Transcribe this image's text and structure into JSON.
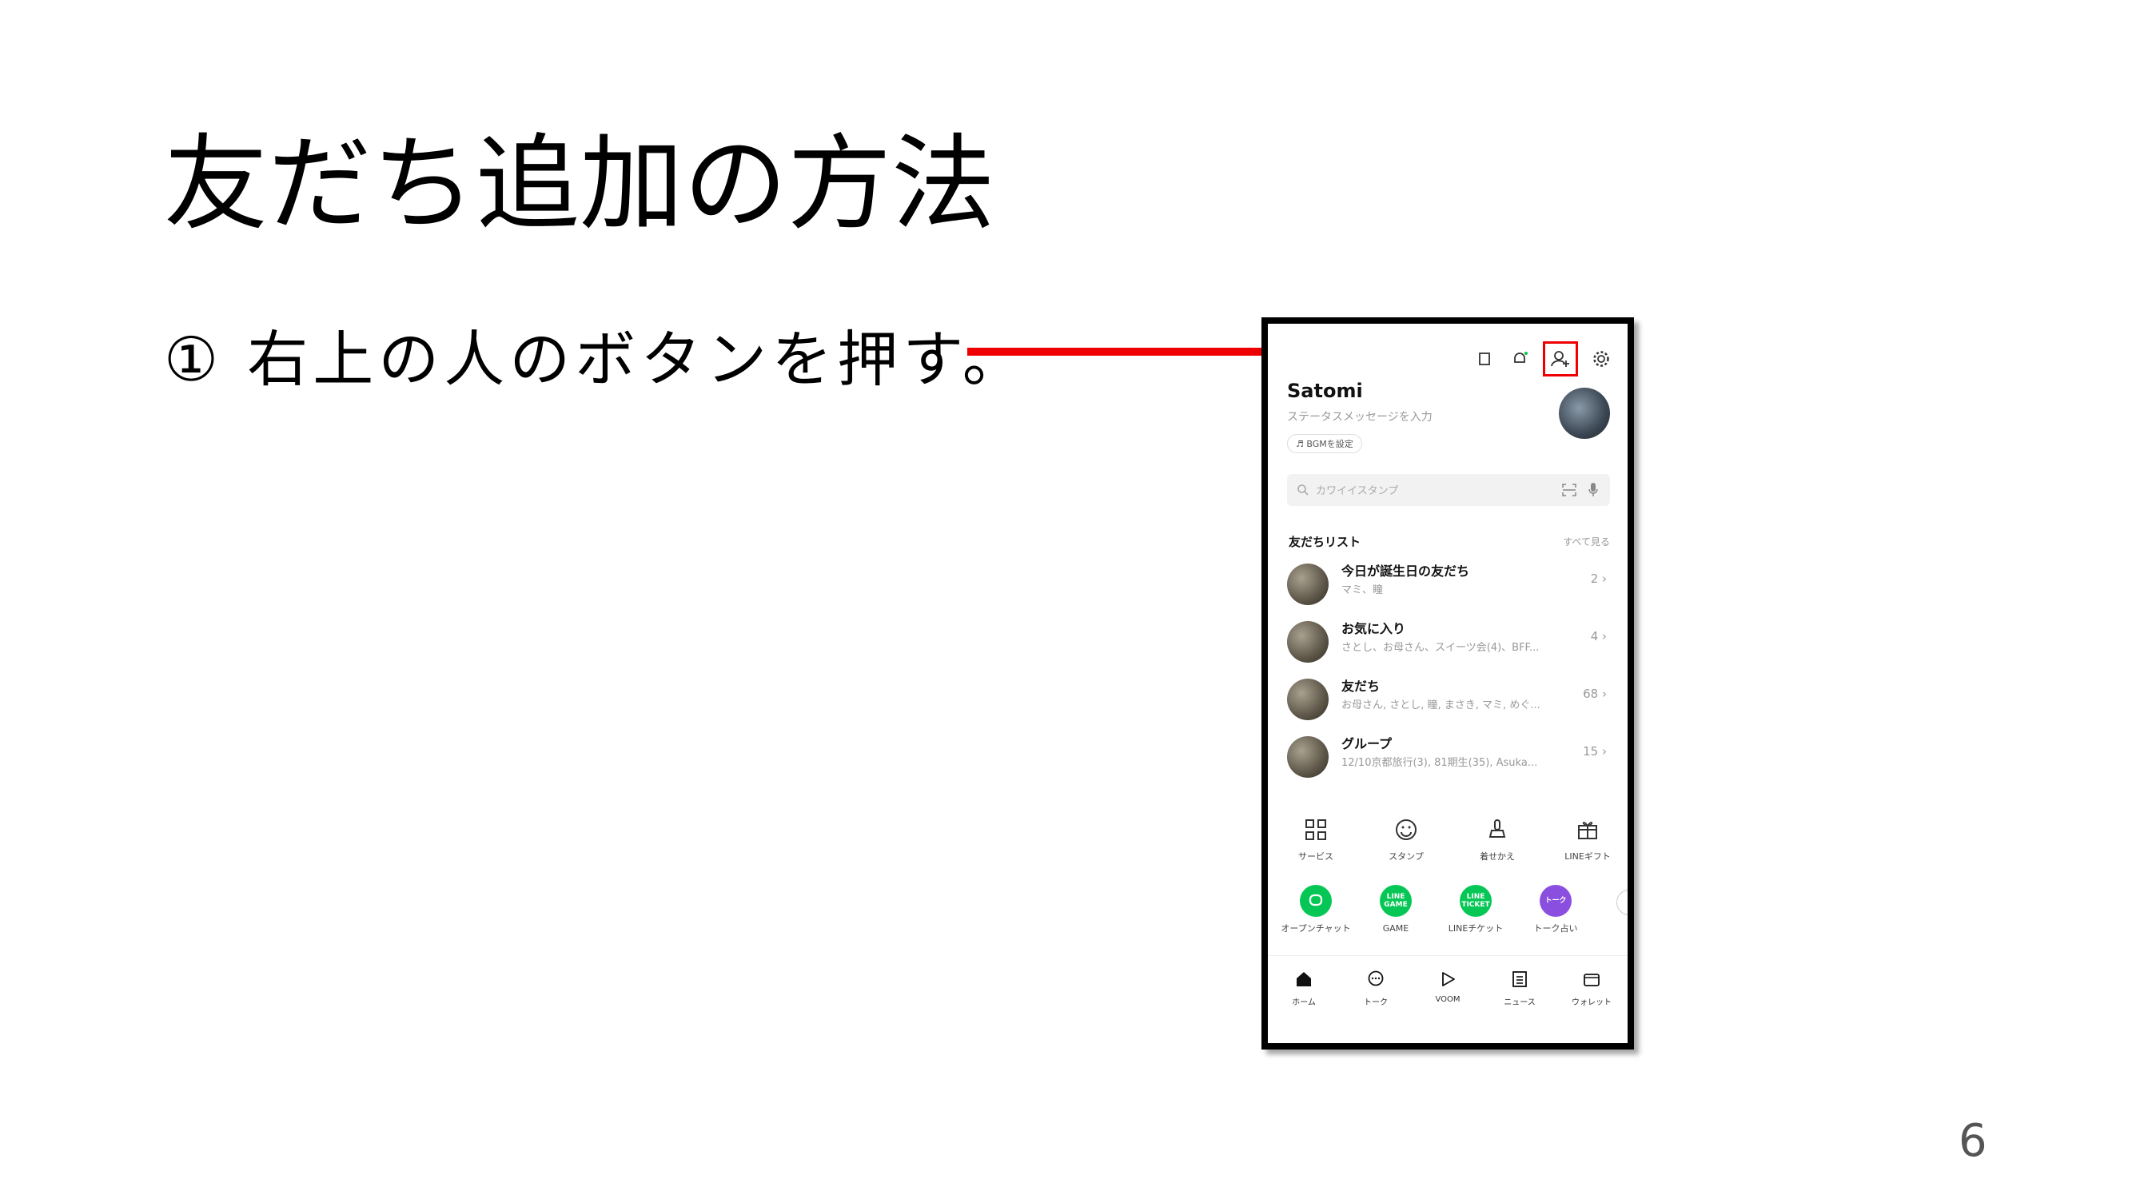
{
  "slide": {
    "title": "友だち追加の方法",
    "step": "① 右上の人のボタンを押す。",
    "page_number": "6"
  },
  "phone": {
    "profile": {
      "name": "Satomi",
      "status_placeholder": "ステータスメッセージを入力",
      "bgm_chip": "♬ BGMを設定"
    },
    "search_placeholder": "カワイイスタンプ",
    "friends_section": {
      "title": "友だちリスト",
      "see_all": "すべて見る"
    },
    "friend_rows": [
      {
        "title": "今日が誕生日の友だち",
        "subtitle": "マミ、瞳",
        "count": "2 ›"
      },
      {
        "title": "お気に入り",
        "subtitle": "さとし、お母さん、スイーツ会(4)、BFF...",
        "count": "4 ›"
      },
      {
        "title": "友だち",
        "subtitle": "お母さん, さとし, 瞳, まさき, マミ, めぐ...",
        "count": "68 ›"
      },
      {
        "title": "グループ",
        "subtitle": "12/10京都旅行(3), 81期生(35), Asuka...",
        "count": "15 ›"
      }
    ],
    "services": [
      "サービス",
      "スタンプ",
      "着せかえ",
      "LINEギフト"
    ],
    "apps": [
      {
        "label": "オープンチャット",
        "badge": "",
        "color": "#06c755"
      },
      {
        "label": "GAME",
        "badge": "LINE GAME",
        "color": "#06c755"
      },
      {
        "label": "LINEチケット",
        "badge": "LINE TICKET",
        "color": "#06c755"
      },
      {
        "label": "トーク占い",
        "badge": "トーク",
        "color": "#8b4fe0"
      }
    ],
    "bottom_nav": [
      "ホーム",
      "トーク",
      "VOOM",
      "ニュース",
      "ウォレット"
    ]
  },
  "colors": {
    "arrow": "#ee0000",
    "highlight": "#ee0000",
    "line_green": "#06c755"
  }
}
